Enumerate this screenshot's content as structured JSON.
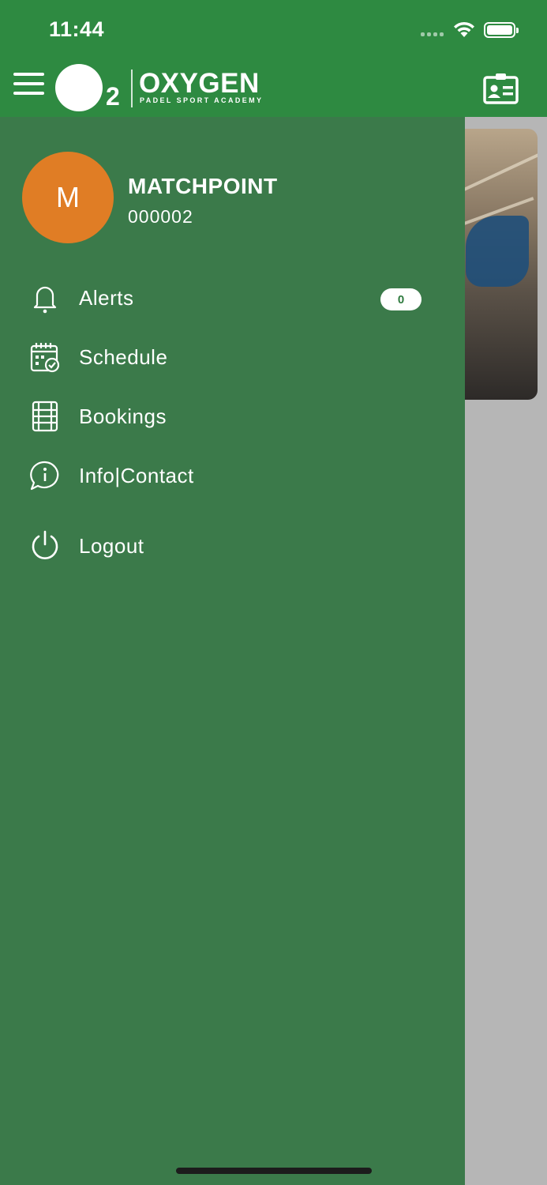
{
  "status_bar": {
    "time": "11:44"
  },
  "header": {
    "logo_mark": "2",
    "logo_name": "OXYGEN",
    "logo_subtitle": "PADEL SPORT ACADEMY",
    "menu_icon": "hamburger-icon",
    "right_icon": "id-card-icon"
  },
  "profile": {
    "initial": "M",
    "name": "MATCHPOINT",
    "id": "000002",
    "avatar_color": "#e07d25"
  },
  "menu": {
    "items": [
      {
        "label": "Alerts",
        "icon": "bell-icon",
        "badge": "0"
      },
      {
        "label": "Schedule",
        "icon": "calendar-check-icon"
      },
      {
        "label": "Bookings",
        "icon": "court-icon"
      },
      {
        "label": "Info|Contact",
        "icon": "info-chat-icon"
      },
      {
        "label": "Logout",
        "icon": "power-icon"
      }
    ]
  },
  "colors": {
    "header": "#2e8a41",
    "drawer": "#3b7a4a",
    "accent": "#e07d25"
  }
}
